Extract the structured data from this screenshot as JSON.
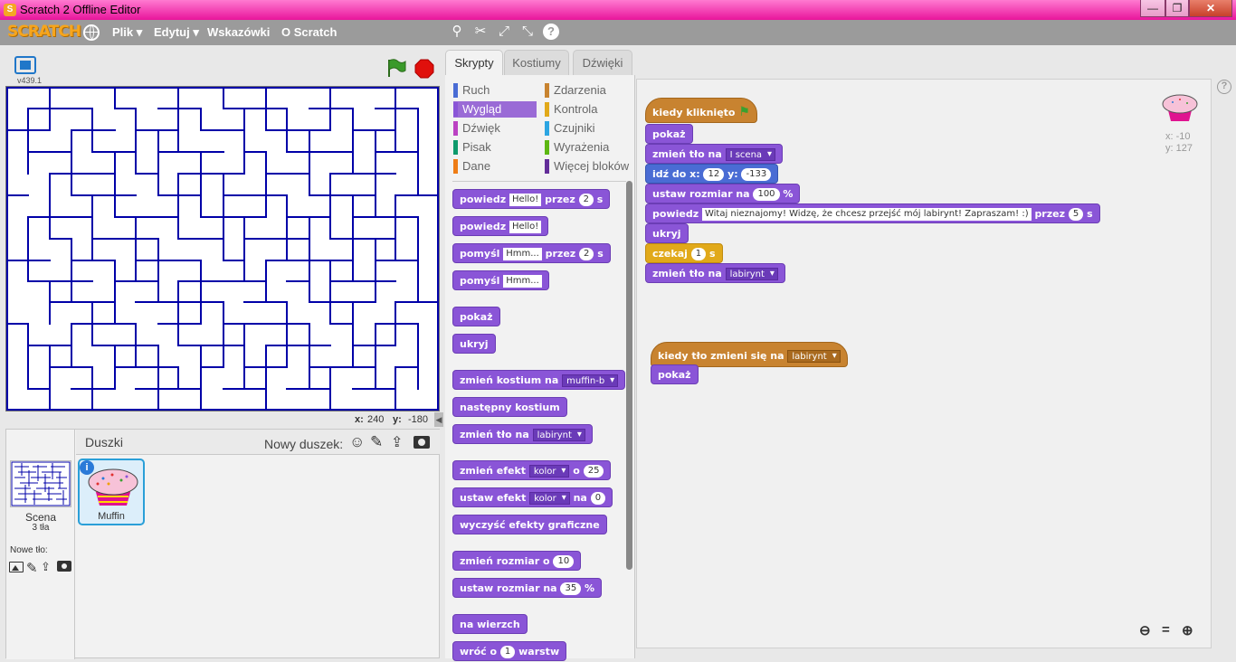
{
  "window": {
    "title": "Scratch 2 Offline Editor",
    "minimize": "—",
    "maximize": "❐",
    "close": "✕"
  },
  "menubar": {
    "logo": "SCRATCH",
    "menus": [
      "Plik ▾",
      "Edytuj ▾",
      "Wskazówki",
      "O Scratch"
    ],
    "tools": [
      "duplicate-icon",
      "cut-icon",
      "grow-icon",
      "shrink-icon",
      "help-icon"
    ]
  },
  "stage": {
    "version": "v439.1",
    "coords": {
      "x_label": "x:",
      "x": "240",
      "y_label": "y:",
      "y": "-180"
    }
  },
  "sprites": {
    "header": "Duszki",
    "new_sprite_label": "Nowy duszek:",
    "scene_label": "Scena",
    "scene_sub": "3 tła",
    "new_backdrop_label": "Nowe tło:",
    "items": [
      {
        "name": "Muffin"
      }
    ]
  },
  "tabs": [
    "Skrypty",
    "Kostiumy",
    "Dźwięki"
  ],
  "categories": {
    "left": [
      {
        "label": "Ruch",
        "color": "#4a6cd4"
      },
      {
        "label": "Wygląd",
        "color": "#8a55d7",
        "selected": true
      },
      {
        "label": "Dźwięk",
        "color": "#bb42c3"
      },
      {
        "label": "Pisak",
        "color": "#0e9a6c"
      },
      {
        "label": "Dane",
        "color": "#ee7d16"
      }
    ],
    "right": [
      {
        "label": "Zdarzenia",
        "color": "#c88330"
      },
      {
        "label": "Kontrola",
        "color": "#e1a91a"
      },
      {
        "label": "Czujniki",
        "color": "#2ca5e2"
      },
      {
        "label": "Wyrażenia",
        "color": "#5cb712"
      },
      {
        "label": "Więcej bloków",
        "color": "#632d99"
      }
    ]
  },
  "palette_blocks": {
    "say_for": {
      "a": "powiedz",
      "b": "Hello!",
      "c": "przez",
      "d": "2",
      "e": "s"
    },
    "say": {
      "a": "powiedz",
      "b": "Hello!"
    },
    "think_for": {
      "a": "pomyśl",
      "b": "Hmm...",
      "c": "przez",
      "d": "2",
      "e": "s"
    },
    "think": {
      "a": "pomyśl",
      "b": "Hmm..."
    },
    "show": "pokaż",
    "hide": "ukryj",
    "switch_costume": {
      "a": "zmień kostium na",
      "b": "muffin-b"
    },
    "next_costume": "następny kostium",
    "switch_backdrop": {
      "a": "zmień tło na",
      "b": "labirynt"
    },
    "change_effect": {
      "a": "zmień efekt",
      "b": "kolor",
      "c": "o",
      "d": "25"
    },
    "set_effect": {
      "a": "ustaw efekt",
      "b": "kolor",
      "c": "na",
      "d": "0"
    },
    "clear_effects": "wyczyść efekty graficzne",
    "change_size": {
      "a": "zmień rozmiar o",
      "b": "10"
    },
    "set_size": {
      "a": "ustaw rozmiar na",
      "b": "35",
      "c": "%"
    },
    "front": "na wierzch",
    "back": {
      "a": "wróć o",
      "b": "1",
      "c": "warstw"
    }
  },
  "script": {
    "when_flag": "kiedy kliknięto",
    "show1": "pokaż",
    "switch_bg": {
      "a": "zmień tło na",
      "b": "I scena"
    },
    "goto": {
      "a": "idź do x:",
      "b": "12",
      "c": "y:",
      "d": "-133"
    },
    "set_size": {
      "a": "ustaw rozmiar na",
      "b": "100",
      "c": "%"
    },
    "say": {
      "a": "powiedz",
      "b": "Witaj nieznajomy! Widzę, że chcesz przejść mój labirynt! Zapraszam! :)",
      "c": "przez",
      "d": "5",
      "e": "s"
    },
    "hide": "ukryj",
    "wait": {
      "a": "czekaj",
      "b": "1",
      "c": "s"
    },
    "switch_bg2": {
      "a": "zmień tło na",
      "b": "labirynt"
    },
    "when_bg": {
      "a": "kiedy tło zmieni się na",
      "b": "labirynt"
    },
    "show2": "pokaż"
  },
  "sprite_info": {
    "x_label": "x:",
    "x": "-10",
    "y_label": "y:",
    "y": "127"
  },
  "colors": {
    "title_bar": "#e9159b",
    "menubar": "#9b9b9b",
    "looks": "#8a55d7",
    "events": "#c88330",
    "control": "#e1a91a",
    "motion": "#4a6cd4",
    "maze": "#0000a8"
  }
}
